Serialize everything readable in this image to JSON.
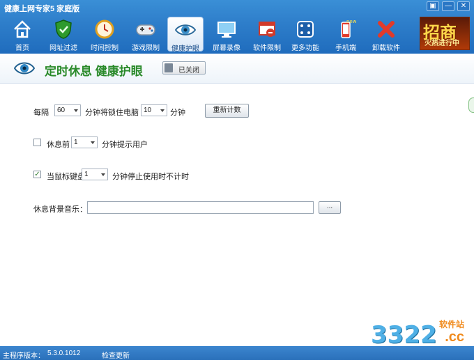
{
  "app": {
    "title": "健康上网专家5 家庭版"
  },
  "window_buttons": [
    "▣",
    "—",
    "✕"
  ],
  "toolbar": [
    {
      "label": "首页",
      "icon": "home-icon"
    },
    {
      "label": "网址过滤",
      "icon": "shield-icon"
    },
    {
      "label": "时间控制",
      "icon": "clock-icon"
    },
    {
      "label": "游戏限制",
      "icon": "gamepad-icon"
    },
    {
      "label": "健康护眼",
      "icon": "eye-icon",
      "active": true
    },
    {
      "label": "屏幕录像",
      "icon": "monitor-icon"
    },
    {
      "label": "软件限制",
      "icon": "software-block-icon"
    },
    {
      "label": "更多功能",
      "icon": "more-icon"
    },
    {
      "label": "手机端",
      "icon": "phone-icon",
      "badge": "new"
    },
    {
      "label": "卸载软件",
      "icon": "uninstall-icon"
    }
  ],
  "promo": {
    "big": "招商",
    "small": "火热进行中"
  },
  "section": {
    "title": "定时休息 健康护眼",
    "toggle_label": "已关闭"
  },
  "form": {
    "rest": {
      "label_every": "每隔",
      "interval_value": "60",
      "label_lock": "分钟将锁住电脑",
      "lock_value": "10",
      "label_minutes": "分钟",
      "reset_label": "重新计数"
    },
    "remind": {
      "checked": false,
      "label_before": "休息前",
      "value": "1",
      "label_after": "分钟提示用户"
    },
    "idle": {
      "checked": true,
      "label_when": "当鼠标键盘",
      "value": "1",
      "label_after": "分钟停止使用时不计时"
    },
    "music": {
      "label": "休息背景音乐：",
      "value": "",
      "browse_label": "..."
    }
  },
  "status": {
    "version_label": "主程序版本：",
    "version_value": "5.3.0.1012",
    "check_update": "检查更新"
  },
  "watermark": {
    "number": "3322",
    "site": "软件站",
    "domain": ".cc"
  },
  "colors": {
    "toolbar_blue": "#2f7fcb",
    "title_green": "#2a8a2a",
    "status_blue": "#2a70ba"
  }
}
